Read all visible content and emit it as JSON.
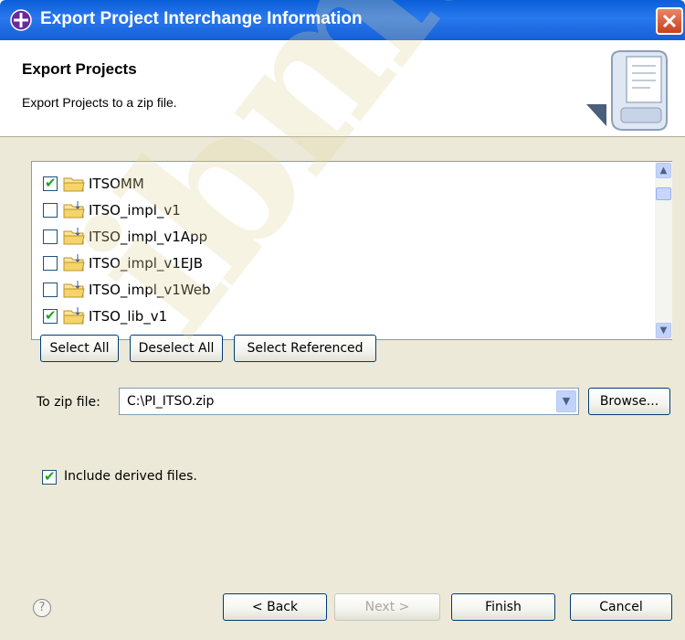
{
  "window": {
    "title": "Export Project Interchange Information",
    "icons": {
      "app": "eclipse-plugin-icon",
      "close": "close-icon"
    }
  },
  "header": {
    "title": "Export Projects",
    "description": "Export Projects to a zip file.",
    "image": "export-wizard-icon"
  },
  "projects": [
    {
      "label": "ITSOMM",
      "checked": true
    },
    {
      "label": "ITSO_impl_v1",
      "checked": false
    },
    {
      "label": "ITSO_impl_v1App",
      "checked": false
    },
    {
      "label": "ITSO_impl_v1EJB",
      "checked": false
    },
    {
      "label": "ITSO_impl_v1Web",
      "checked": false
    },
    {
      "label": "ITSO_lib_v1",
      "checked": true
    }
  ],
  "selection_buttons": {
    "select_all": "Select All",
    "deselect_all": "Deselect All",
    "select_referenced": "Select Referenced"
  },
  "zip": {
    "label": "To zip file:",
    "value": "C:\\PI_ITSO.zip",
    "browse": "Browse..."
  },
  "options": {
    "include_derived_label": "Include derived files.",
    "include_derived_checked": true
  },
  "footer": {
    "help": "?",
    "back": "< Back",
    "next": "Next >",
    "finish": "Finish",
    "cancel": "Cancel"
  },
  "colors": {
    "titlebar": "#0a5fd8",
    "dialog_bg": "#ece9d8",
    "checkmark": "#21a121"
  },
  "watermark": "ibm.com/redbooks"
}
